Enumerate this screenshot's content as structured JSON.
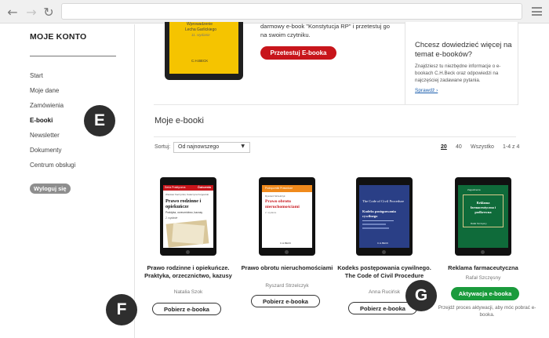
{
  "browser": {
    "back_icon": "arrow-left-icon",
    "forward_icon": "arrow-right-icon",
    "reload_icon": "reload-icon",
    "menu_icon": "hamburger-icon"
  },
  "sidebar": {
    "title": "MOJE KONTO",
    "items": [
      {
        "label": "Start"
      },
      {
        "label": "Moje dane"
      },
      {
        "label": "Zamówienia"
      },
      {
        "label": "E-booki"
      },
      {
        "label": "Newsletter"
      },
      {
        "label": "Dokumenty"
      },
      {
        "label": "Centrum obsługi"
      }
    ],
    "logout_label": "Wyloguj się"
  },
  "promo": {
    "text": "darmowy e-book \"Konstytucja RP\" i przetestuj go na swoim czytniku.",
    "button_label": "Przetestuj E-booka",
    "cover_line1": "Wprowadzenie",
    "cover_line2": "Lecha Garlickiego",
    "cover_edition": "11. wydanie",
    "cover_publisher": "C.H.BECK"
  },
  "info_box": {
    "heading": "Chcesz dowiedzieć więcej na temat e-booków?",
    "body": "Znajdziesz tu niezbędne informacje o e-bookach C.H.Beck oraz odpowiedzi na najczęściej zadawane pytania.",
    "link_label": "Sprawdź ›"
  },
  "ebooks": {
    "title": "Moje e-booki",
    "sort_label": "Sortuj:",
    "sort_value": "Od najnowszego",
    "per_page": [
      "20",
      "40",
      "Wszystko"
    ],
    "range": "1-4 z 4",
    "items": [
      {
        "title": "Prawo rodzinne i opiekuńcze. Praktyka, orzecznictwo, kazusy",
        "author": "Natalia Szok",
        "button_label": "Pobierz e-booka",
        "cover_series": "Seria Praktyczna",
        "cover_brand": "Ćwiczenia",
        "cover_authors": "Wieslaw Kaczyński, Katarzyna Kulgowski",
        "cover_title": "Prawo rodzinne i opiekuńcze",
        "cover_subtitle": "Praktyka, orzecznictwo, kazusy",
        "cover_edition": "2. wydanie"
      },
      {
        "title": "Prawo obrotu nieruchomościami",
        "author": "Ryszard Strzelczyk",
        "button_label": "Pobierz e-booka",
        "cover_series": "Podręczniki Prawnicze",
        "cover_author": "Ryszard Strzelczyk",
        "cover_title": "Prawo obrotu nieruchomościami",
        "cover_edition": "2. wydanie",
        "cover_publisher": "C.H.BECK"
      },
      {
        "title": "Kodeks postępowania cywilnego. The Code of Civil Procedure",
        "author": "Anna Rucińsk",
        "button_label": "Pobierz e-booka",
        "cover_title_en": "The Code of Civil Procedure",
        "cover_title_pl": "Kodeks postępowania cywilnego",
        "cover_publisher": "C.H.BECK"
      },
      {
        "title": "Reklama farmaceutyczna",
        "author": "Rafał Szczęsny",
        "button_label": "Aktywacja e-booka",
        "note": "Przejdź proces aktywacji, aby móc pobrać e-booka.",
        "cover_series": "Zagadnienia",
        "cover_title": "Reklama farmaceutyczna i podkrewna",
        "cover_author": "Rafał Szczęsny"
      }
    ]
  },
  "markers": [
    "E",
    "F",
    "G"
  ],
  "colors": {
    "brand_red": "#c8151b",
    "activation_green": "#1a9b3c",
    "marker_dark": "#2e2e2e",
    "link_blue": "#1c5fae"
  }
}
